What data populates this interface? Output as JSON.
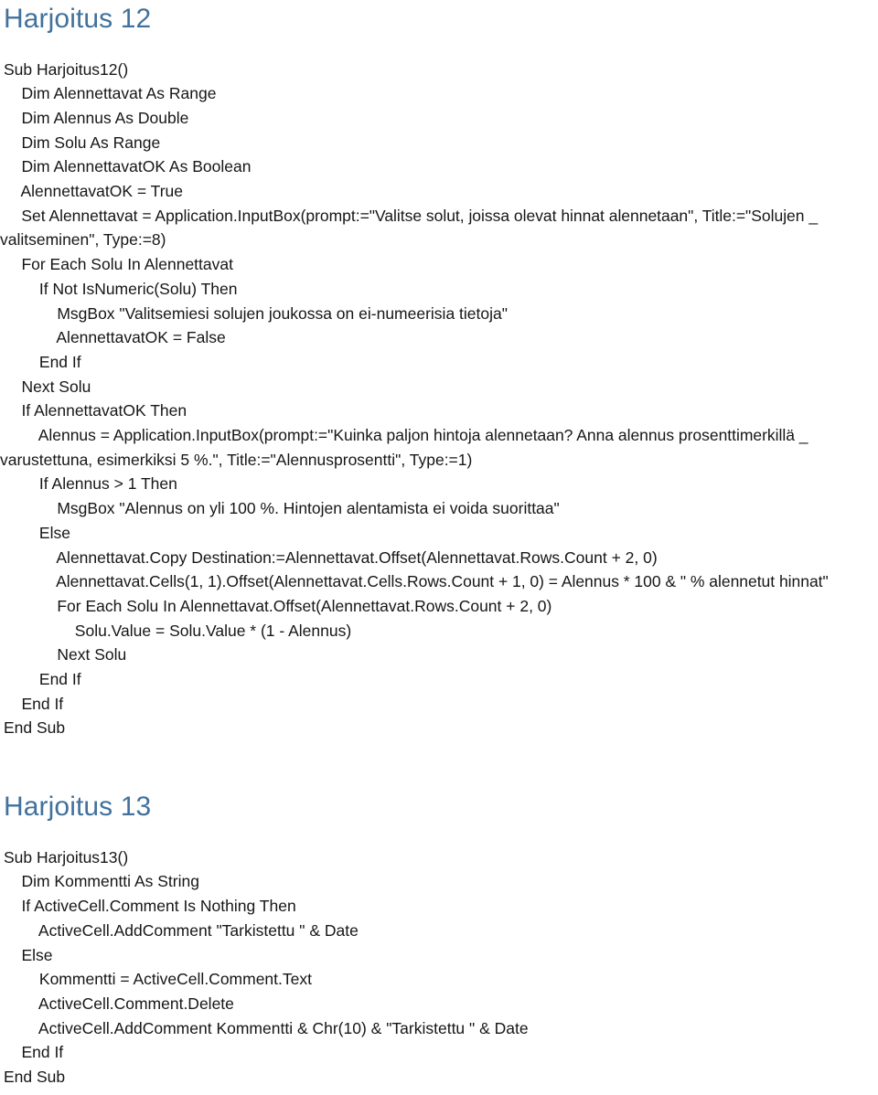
{
  "document": {
    "heading_color": "#41719C",
    "body_color": "#161616",
    "background": "#ffffff"
  },
  "sections": [
    {
      "heading": "Harjoitus 12",
      "lines": [
        "Sub Harjoitus12()",
        "    Dim Alennettavat As Range",
        "    Dim Alennus As Double",
        "    Dim Solu As Range",
        "    Dim AlennettavatOK As Boolean",
        "    AlennettavatOK = True",
        "    Set Alennettavat = Application.InputBox(prompt:=\"Valitse solut, joissa olevat hinnat alennetaan\", Title:=\"Solujen _",
        "valitseminen\", Type:=8)",
        "    For Each Solu In Alennettavat",
        "        If Not IsNumeric(Solu) Then",
        "            MsgBox \"Valitsemiesi solujen joukossa on ei-numeerisia tietoja\"",
        "            AlennettavatOK = False",
        "        End If",
        "    Next Solu",
        "    If AlennettavatOK Then",
        "        Alennus = Application.InputBox(prompt:=\"Kuinka paljon hintoja alennetaan? Anna alennus prosenttimerkillä _",
        "varustettuna, esimerkiksi 5 %.\", Title:=\"Alennusprosentti\", Type:=1)",
        "        If Alennus > 1 Then",
        "            MsgBox \"Alennus on yli 100 %. Hintojen alentamista ei voida suorittaa\"",
        "        Else",
        "            Alennettavat.Copy Destination:=Alennettavat.Offset(Alennettavat.Rows.Count + 2, 0)",
        "            Alennettavat.Cells(1, 1).Offset(Alennettavat.Cells.Rows.Count + 1, 0) = Alennus * 100 & \" % alennetut hinnat\"",
        "            For Each Solu In Alennettavat.Offset(Alennettavat.Rows.Count + 2, 0)",
        "                Solu.Value = Solu.Value * (1 - Alennus)",
        "            Next Solu",
        "        End If",
        "    End If",
        "End Sub"
      ],
      "wrapped_line_indices": [
        7,
        16
      ]
    },
    {
      "heading": "Harjoitus 13",
      "lines": [
        "Sub Harjoitus13()",
        "    Dim Kommentti As String",
        "    If ActiveCell.Comment Is Nothing Then",
        "        ActiveCell.AddComment \"Tarkistettu \" & Date",
        "    Else",
        "        Kommentti = ActiveCell.Comment.Text",
        "        ActiveCell.Comment.Delete",
        "        ActiveCell.AddComment Kommentti & Chr(10) & \"Tarkistettu \" & Date",
        "    End If",
        "End Sub"
      ],
      "wrapped_line_indices": []
    }
  ]
}
